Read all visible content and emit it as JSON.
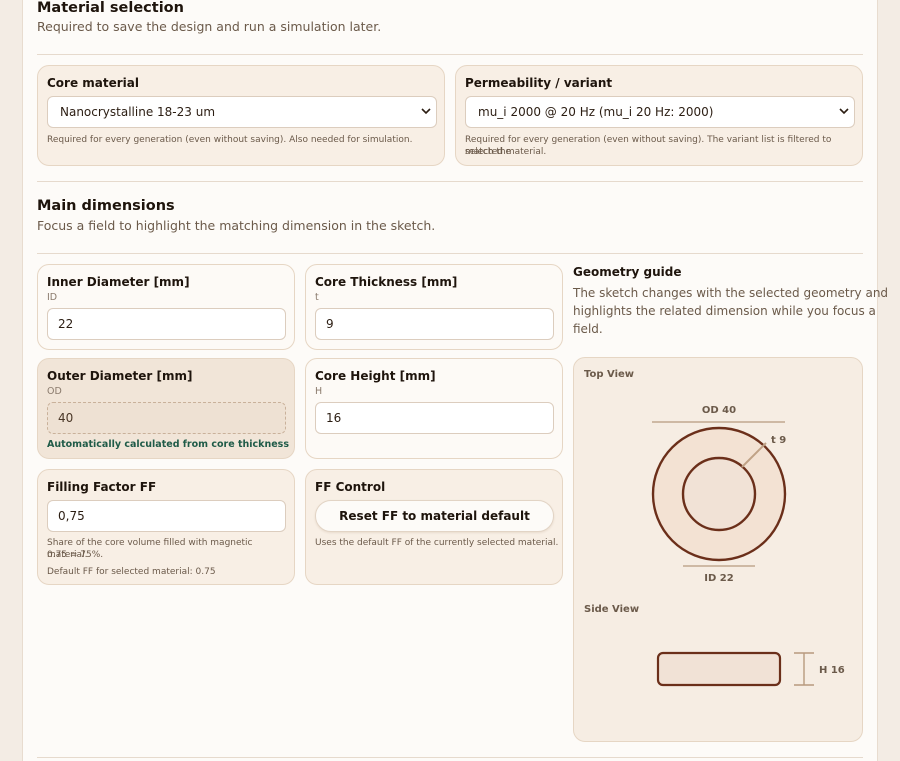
{
  "material_section": {
    "title": "Material selection",
    "subtitle": "Required to save the design and run a simulation later.",
    "core_material": {
      "label": "Core material",
      "selected": "Nanocrystalline 18-23 um",
      "help": "Required for every generation (even without saving). Also needed for simulation."
    },
    "permeability": {
      "label": "Permeability / variant",
      "selected": "mu_i 2000 @ 20 Hz (mu_i 20 Hz: 2000)",
      "help_line1": "Required for every generation (even without saving). The variant list is filtered to match the",
      "help_line2": "selected material."
    }
  },
  "dimensions_section": {
    "title": "Main dimensions",
    "subtitle": "Focus a field to highlight the matching dimension in the sketch.",
    "inner_diameter": {
      "label": "Inner Diameter [mm]",
      "code": "ID",
      "value": "22"
    },
    "core_thickness": {
      "label": "Core Thickness [mm]",
      "code": "t",
      "value": "9"
    },
    "outer_diameter": {
      "label": "Outer Diameter [mm]",
      "code": "OD",
      "value": "40",
      "note": "Automatically calculated from core thickness"
    },
    "core_height": {
      "label": "Core Height [mm]",
      "code": "H",
      "value": "16"
    },
    "filling_factor": {
      "label": "Filling Factor FF",
      "value": "0,75",
      "help_line1": "Share of the core volume filled with magnetic material.",
      "help_line2": "0.75 = 75%.",
      "help_line3": "Default FF for selected material: 0.75"
    },
    "ff_control": {
      "label": "FF Control",
      "button": "Reset FF to material default",
      "help": "Uses the default FF of the currently selected material."
    }
  },
  "geometry_guide": {
    "title": "Geometry guide",
    "text_line1": "The sketch changes with the selected geometry and",
    "text_line2": "highlights the related dimension while you focus a",
    "text_line3": "field.",
    "top_view_label": "Top View",
    "side_view_label": "Side View",
    "od_label": "OD 40",
    "id_label": "ID 22",
    "t_label": "t 9",
    "h_label": "H 16"
  },
  "colors": {
    "accent": "#6b2f1a",
    "card_bg": "#f8efe5",
    "green_note": "#1f5b48"
  }
}
